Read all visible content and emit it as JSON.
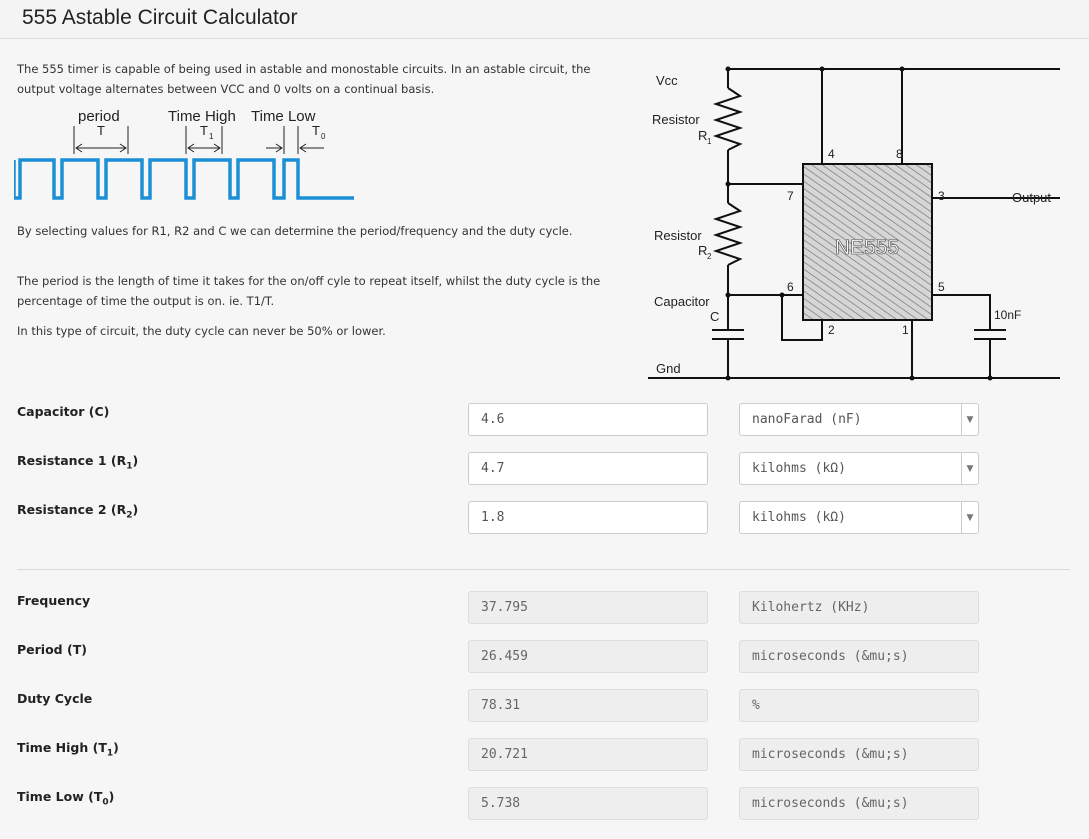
{
  "page": {
    "title": "555 Astable Circuit Calculator"
  },
  "intro": {
    "p1": "The 555 timer is capable of being used in astable and monostable circuits. In an astable circuit, the output voltage alternates between VCC and 0 volts on a continual basis.",
    "p2": "By selecting values for R1, R2 and C we can determine the period/frequency and the duty cycle.",
    "p3": "The period is the length of time it takes for the on/off cyle to repeat itself, whilst the duty cycle is the percentage of time the output is on. ie. T1/T.",
    "p4": "In this type of circuit, the duty cycle can never be 50% or lower."
  },
  "waveform": {
    "period_label": "period",
    "period_symbol": "T",
    "high_label": "Time High",
    "high_symbol": "T",
    "high_sub": "1",
    "low_label": "Time Low",
    "low_symbol": "T",
    "low_sub": "0"
  },
  "circuit": {
    "vcc": "Vcc",
    "r1_label": "Resistor",
    "r1_sym": "R",
    "r1_sub": "1",
    "r2_label": "Resistor",
    "r2_sym": "R",
    "r2_sub": "2",
    "cap_label": "Capacitor",
    "cap_sym": "C",
    "gnd": "Gnd",
    "chip": "NE555",
    "pin4": "4",
    "pin8": "8",
    "pin7": "7",
    "pin3": "3",
    "pin6": "6",
    "pin5": "5",
    "pin2": "2",
    "pin1": "1",
    "output": "Output",
    "cap2": "10nF"
  },
  "inputs": [
    {
      "label": "Capacitor (C)",
      "value": "4.6",
      "unit": "nanoFarad (nF)"
    },
    {
      "label": "Resistance 1 (R",
      "sub": "1",
      "tail": ")",
      "value": "4.7",
      "unit": "kilohms (kΩ)"
    },
    {
      "label": "Resistance 2 (R",
      "sub": "2",
      "tail": ")",
      "value": "1.8",
      "unit": "kilohms (kΩ)"
    }
  ],
  "outputs": [
    {
      "label": "Frequency",
      "value": "37.795",
      "unit": "Kilohertz (KHz)"
    },
    {
      "label": "Period (T)",
      "value": "26.459",
      "unit": "microseconds (&mu;s)"
    },
    {
      "label": "Duty Cycle",
      "value": "78.31",
      "unit": "%"
    },
    {
      "label": "Time High (T",
      "sub": "1",
      "tail": ")",
      "value": "20.721",
      "unit": "microseconds (&mu;s)"
    },
    {
      "label": "Time Low (T",
      "sub": "0",
      "tail": ")",
      "value": "5.738",
      "unit": "microseconds (&mu;s)"
    }
  ]
}
